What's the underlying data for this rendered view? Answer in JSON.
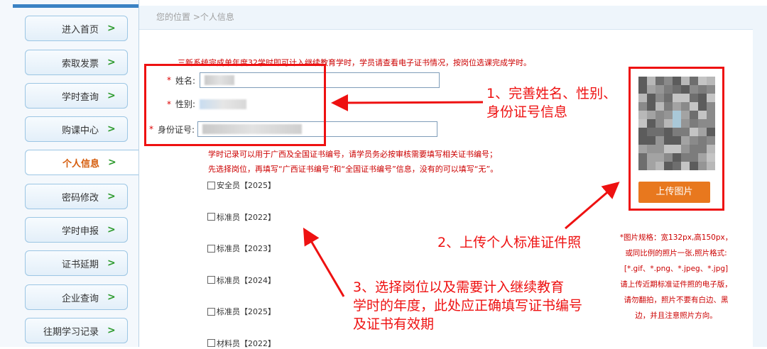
{
  "sidebar": {
    "items": [
      {
        "label": "进入首页",
        "active": false
      },
      {
        "label": "索取发票",
        "active": false
      },
      {
        "label": "学时查询",
        "active": false
      },
      {
        "label": "购课中心",
        "active": false
      },
      {
        "label": "个人信息",
        "active": true
      },
      {
        "label": "密码修改",
        "active": false
      },
      {
        "label": "学时申报",
        "active": false
      },
      {
        "label": "证书延期",
        "active": false
      },
      {
        "label": "企业查询",
        "active": false
      },
      {
        "label": "往期学习记录",
        "active": false
      }
    ],
    "arrow_glyph": ">"
  },
  "breadcrumb": "您的位置 >个人信息",
  "notice": "三新系统完成单年度32学时即可计入继续教育学时，学员请查看电子证书情况，按岗位选课完成学时。",
  "form": {
    "required_mark": "*",
    "name_label": "姓名:",
    "gender_label": "性别:",
    "id_label": "身份证号:"
  },
  "hints": [
    "学时记录可以用于广西及全国证书编号，请学员务必按审核需要填写相关证书编号；",
    "先选择岗位，再填写“广西证书编号”和“全国证书编号”信息，没有的可以填写“无”。"
  ],
  "certificates": [
    {
      "label": "安全员【2025】",
      "checked": false
    },
    {
      "label": "标准员【2022】",
      "checked": false
    },
    {
      "label": "标准员【2023】",
      "checked": false
    },
    {
      "label": "标准员【2024】",
      "checked": false
    },
    {
      "label": "标准员【2025】",
      "checked": false
    },
    {
      "label": "材料员【2022】",
      "checked": false
    }
  ],
  "upload_button": "上传图片",
  "photo_spec": [
    "*图片规格：宽132px,高150px，",
    "或同比例的照片一张,照片格式:",
    "[*.gif、*.png、*.jpeg、*.jpg]",
    "请上传近期标准证件照的电子版，",
    "请勿翻拍，照片不要有白边、黑",
    "边，并且注意照片方向。"
  ],
  "annotations": [
    {
      "lines": [
        "1、完善姓名、性别、",
        "身份证号信息"
      ]
    },
    {
      "lines": [
        "2、上传个人标准证件照"
      ]
    },
    {
      "lines": [
        "3、选择岗位以及需要计入继续教育",
        "学时的年度，此处应正确填写证书编号",
        "及证书有效期"
      ]
    }
  ],
  "colors": {
    "accent_blue": "#3a82c4",
    "annotation_red": "#e11",
    "upload_orange": "#e8781e",
    "active_nav": "#d55b0a",
    "nav_arrow": "#2c9a2c"
  }
}
